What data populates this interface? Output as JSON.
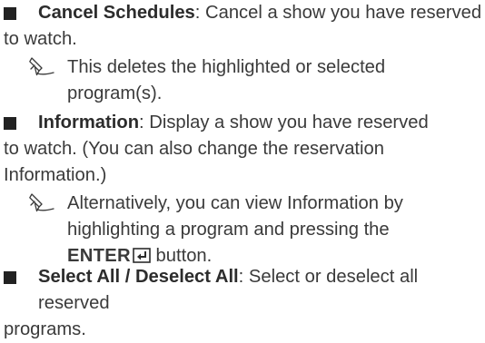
{
  "items": [
    {
      "term": "Cancel Schedules",
      "desc_line1": ": Cancel a show you have reserved",
      "desc_line2": "to watch."
    },
    {
      "term": "Information",
      "desc_line1": ": Display a show you have reserved",
      "desc_line2": "to watch. (You can also change the reservation",
      "desc_line3": "Information.)"
    },
    {
      "term": "Select All / Deselect All",
      "desc_line1": ": Select or deselect all reserved",
      "desc_line2": "programs."
    }
  ],
  "notes": [
    {
      "line1": "This deletes the highlighted or selected",
      "line2": "program(s)."
    },
    {
      "line1": "Alternatively, you can view Information by",
      "line2": "highlighting a program and pressing the",
      "enter_label": "ENTER",
      "line3_after": " button."
    }
  ],
  "icons": {
    "note": "pencil-note-icon",
    "enter": "enter-return-icon",
    "bullet": "square-bullet"
  }
}
